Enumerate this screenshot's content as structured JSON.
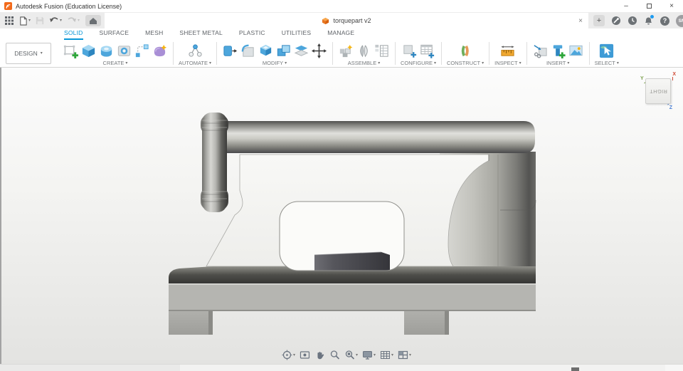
{
  "glyphs": {
    "caret": "▾",
    "plus": "+",
    "close": "×",
    "minimize": "–",
    "question": "?"
  },
  "window": {
    "title": "Autodesk Fusion (Education License)"
  },
  "quick_access": {
    "icons": [
      "app-launcher-grid",
      "file",
      "save",
      "undo",
      "redo",
      "home"
    ]
  },
  "tab_bar": {
    "document_tab": {
      "label": "torquepart v2",
      "icon": "document-cube"
    },
    "right_icons": [
      "new-tab",
      "extensions",
      "job-status",
      "notifications",
      "help"
    ],
    "notification_dot_color": "#1d9bf0",
    "avatar": "SM"
  },
  "ribbon": {
    "context_menu": {
      "label": "DESIGN"
    },
    "accent_color": "#0696d7",
    "tabs": [
      {
        "label": "SOLID",
        "active": true
      },
      {
        "label": "SURFACE",
        "active": false
      },
      {
        "label": "MESH",
        "active": false
      },
      {
        "label": "SHEET METAL",
        "active": false
      },
      {
        "label": "PLASTIC",
        "active": false
      },
      {
        "label": "UTILITIES",
        "active": false
      },
      {
        "label": "MANAGE",
        "active": false
      }
    ],
    "groups": [
      {
        "label": "CREATE",
        "icons": [
          "create-sketch",
          "extrude",
          "revolve",
          "hole",
          "rectangular-pattern",
          "create-form"
        ]
      },
      {
        "label": "AUTOMATE",
        "icons": [
          "automated-modeling"
        ]
      },
      {
        "label": "MODIFY",
        "icons": [
          "press-pull",
          "fillet",
          "shell",
          "combine",
          "split-body",
          "move-copy"
        ]
      },
      {
        "label": "ASSEMBLE",
        "icons": [
          "new-component",
          "joint",
          "rigid-group"
        ]
      },
      {
        "label": "CONFIGURE",
        "icons": [
          "configuration",
          "configuration-table"
        ]
      },
      {
        "label": "CONSTRUCT",
        "icons": [
          "construction-plane"
        ]
      },
      {
        "label": "INSPECT",
        "icons": [
          "measure"
        ]
      },
      {
        "label": "INSERT",
        "icons": [
          "insert-derive",
          "insert-fastener",
          "canvas"
        ]
      },
      {
        "label": "SELECT",
        "icons": [
          "select"
        ]
      }
    ]
  },
  "viewport": {
    "viewcube": {
      "face": "RIGHT",
      "axes": {
        "x": {
          "label": "X",
          "color": "#cf4a36"
        },
        "y": {
          "label": "Y",
          "color": "#7ba04c"
        },
        "z": {
          "label": "Z",
          "color": "#4a7fd4"
        }
      }
    },
    "nav_toolbar": [
      "orbit",
      "look-at",
      "pan",
      "zoom",
      "window-zoom",
      "display-settings",
      "grid-settings",
      "viewports"
    ]
  }
}
